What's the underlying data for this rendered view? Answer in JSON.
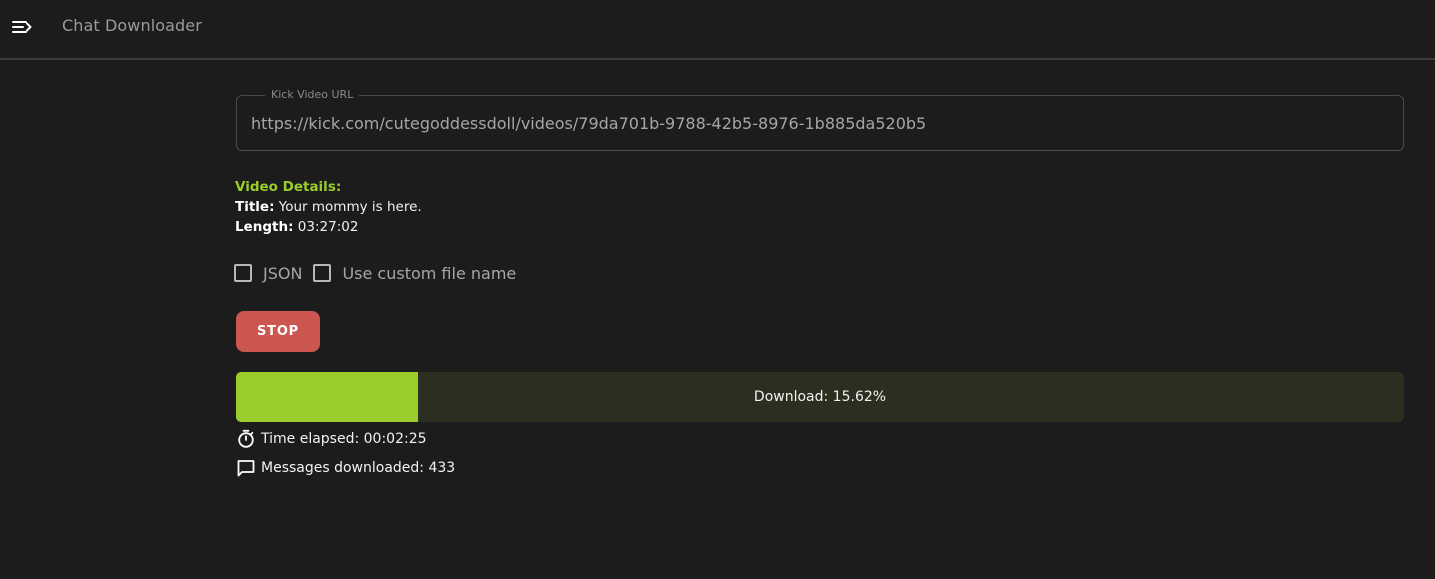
{
  "appbar": {
    "menu_icon": "menu-open-icon",
    "title": "Chat Downloader"
  },
  "url_field": {
    "label": "Kick Video URL",
    "value": "https://kick.com/cutegoddessdoll/videos/79da701b-9788-42b5-8976-1b885da520b5"
  },
  "details": {
    "heading": "Video Details:",
    "title_label": "Title:",
    "title_value": "Your mommy is here.",
    "length_label": "Length:",
    "length_value": "03:27:02"
  },
  "options": [
    {
      "label": "JSON",
      "checked": false
    },
    {
      "label": "Use custom file name",
      "checked": false
    }
  ],
  "stop_button": {
    "label": "STOP",
    "color": "#cc5751"
  },
  "progress": {
    "label": "Download: 15.62%",
    "fraction": 0.1562,
    "fill_color": "#9acd2b",
    "track_color": "#2c2f1f"
  },
  "stats": {
    "elapsed_icon": "timer-icon",
    "elapsed": "Time elapsed: 00:02:25",
    "messages_icon": "chat-bubble-icon",
    "messages": "Messages downloaded: 433"
  },
  "accent_color": "#9acd2b"
}
